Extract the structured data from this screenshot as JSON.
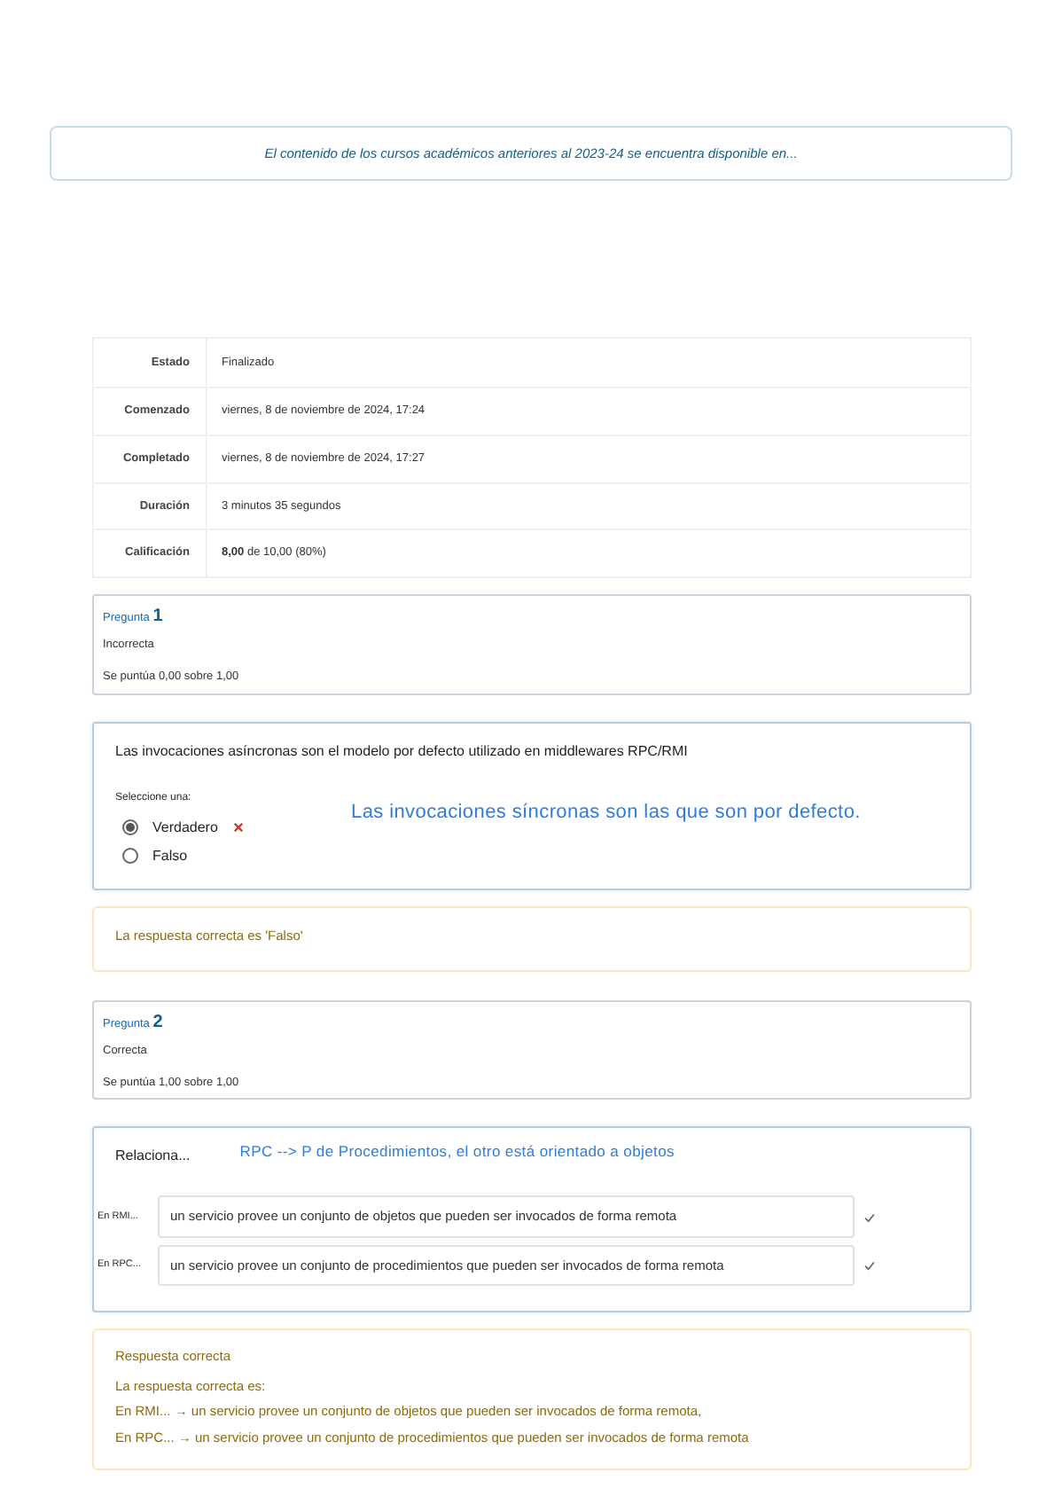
{
  "notice": "El contenido de los cursos académicos anteriores al 2023-24 se encuentra disponible en...",
  "summary": [
    {
      "label": "Estado",
      "value": "Finalizado"
    },
    {
      "label": "Comenzado",
      "value": "viernes, 8 de noviembre de 2024, 17:24"
    },
    {
      "label": "Completado",
      "value": "viernes, 8 de noviembre de 2024, 17:27"
    },
    {
      "label": "Duración",
      "value": "3 minutos 35 segundos"
    },
    {
      "label": "Calificación",
      "value": "**8,00** de 10,00 (80%)"
    }
  ],
  "questions": [
    {
      "kind": "truefalse",
      "label": "Pregunta",
      "number": "1",
      "status": "Incorrecta",
      "score": "Se puntúa 0,00 sobre 1,00",
      "prompt": "Las invocaciones asíncronas son el modelo por defecto utilizado en middlewares RPC/RMI",
      "select_label": "Seleccione una:",
      "annotation": "Las invocaciones síncronas son las que son por defecto.",
      "options": [
        {
          "label": "Verdadero",
          "selected": true,
          "incorrect": true
        },
        {
          "label": "Falso",
          "selected": false,
          "incorrect": false
        }
      ],
      "feedback": [
        "La respuesta correcta es 'Falso'"
      ]
    },
    {
      "kind": "match",
      "label": "Pregunta",
      "number": "2",
      "status": "Correcta",
      "score": "Se puntúa 1,00 sobre 1,00",
      "prompt": "Relaciona...",
      "annotation": "RPC --> P de Procedimientos, el otro está orientado a objetos",
      "rows": [
        {
          "label": "En RMI...",
          "answer": "un servicio provee un conjunto de objetos que pueden ser invocados de forma remota",
          "correct": true
        },
        {
          "label": "En RPC...",
          "answer": "un servicio provee un conjunto de procedimientos que pueden ser invocados de forma remota",
          "correct": true
        }
      ],
      "feedback": [
        "Respuesta correcta",
        "La respuesta correcta es:",
        "En RMI... → un servicio provee un conjunto de objetos que pueden ser invocados de forma remota,",
        "En RPC... → un servicio provee un conjunto de procedimientos que pueden ser invocados de forma remota"
      ]
    }
  ]
}
